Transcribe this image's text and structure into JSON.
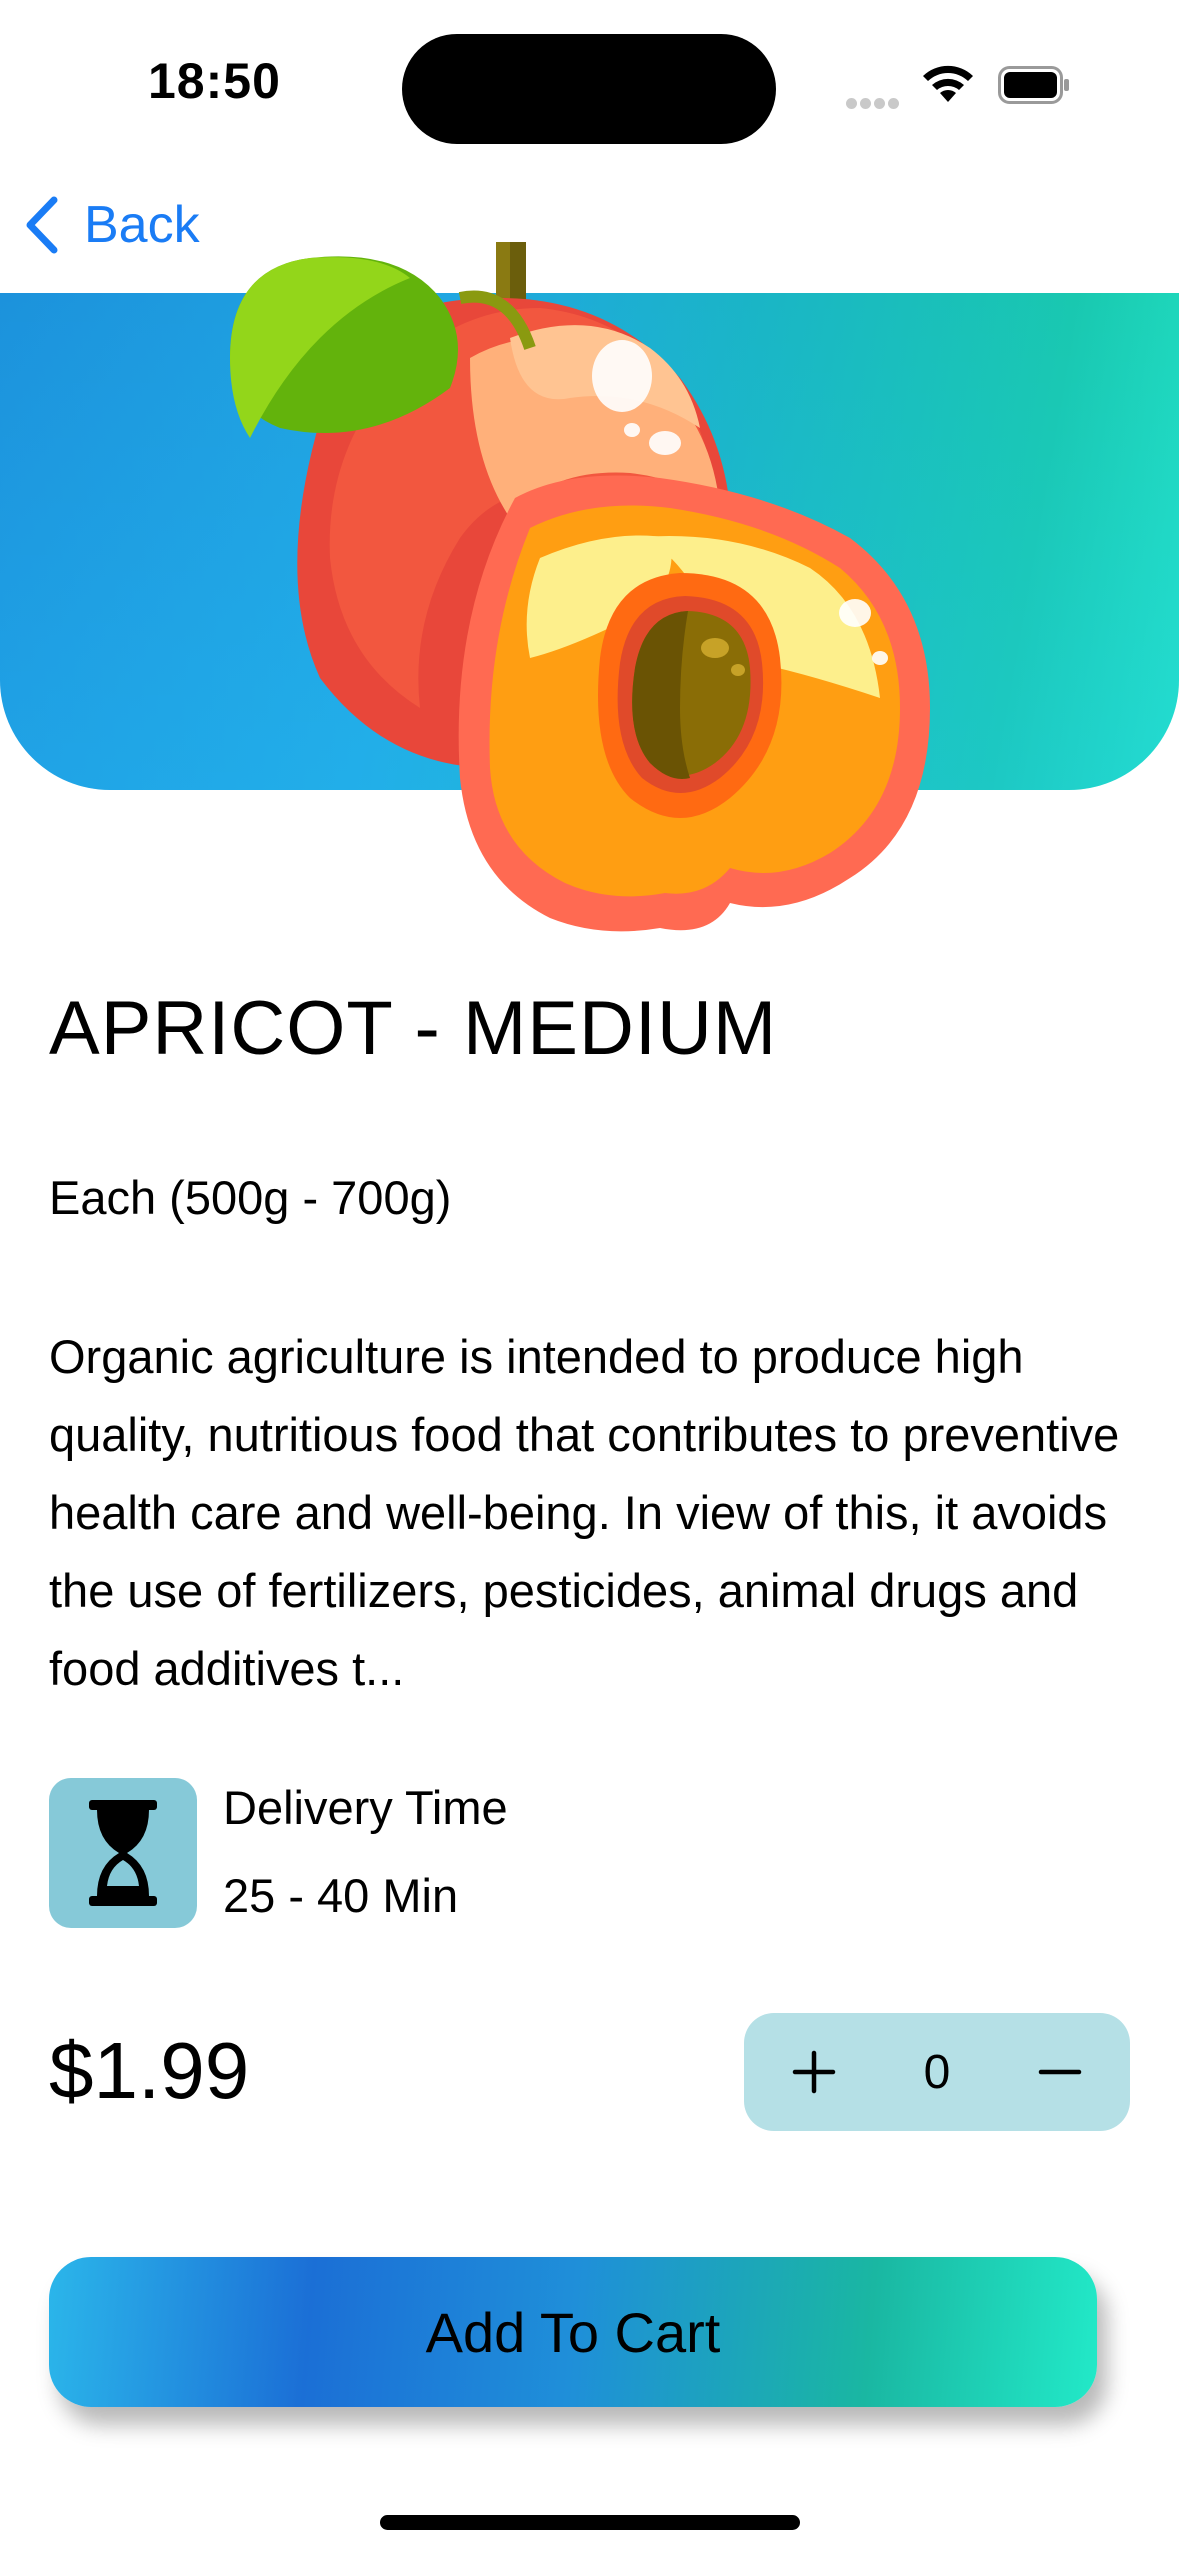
{
  "status_bar": {
    "time": "18:50"
  },
  "nav": {
    "back_label": "Back"
  },
  "product": {
    "title": "APRICOT - MEDIUM",
    "unit": "Each (500g - 700g)",
    "description": "Organic agriculture is intended to produce high quality, nutritious food that contributes to preventive health care and well-being. In view of this, it avoids the use of fertilizers, pesticides, animal drugs and food additives t...",
    "image_icon": "apricot-illustration"
  },
  "delivery": {
    "icon": "hourglass-icon",
    "label": "Delivery Time",
    "value": "25 - 40 Min"
  },
  "price": "$1.99",
  "stepper": {
    "quantity": "0",
    "plus_icon": "plus-icon",
    "minus_icon": "minus-icon"
  },
  "cart": {
    "button_label": "Add To Cart"
  },
  "colors": {
    "accent_blue": "#1a7cf5",
    "gradient_start": "#1c92dc",
    "gradient_end": "#22e2c4",
    "stepper_bg": "#b5e0e6",
    "delivery_icon_bg": "#86c9d8"
  }
}
